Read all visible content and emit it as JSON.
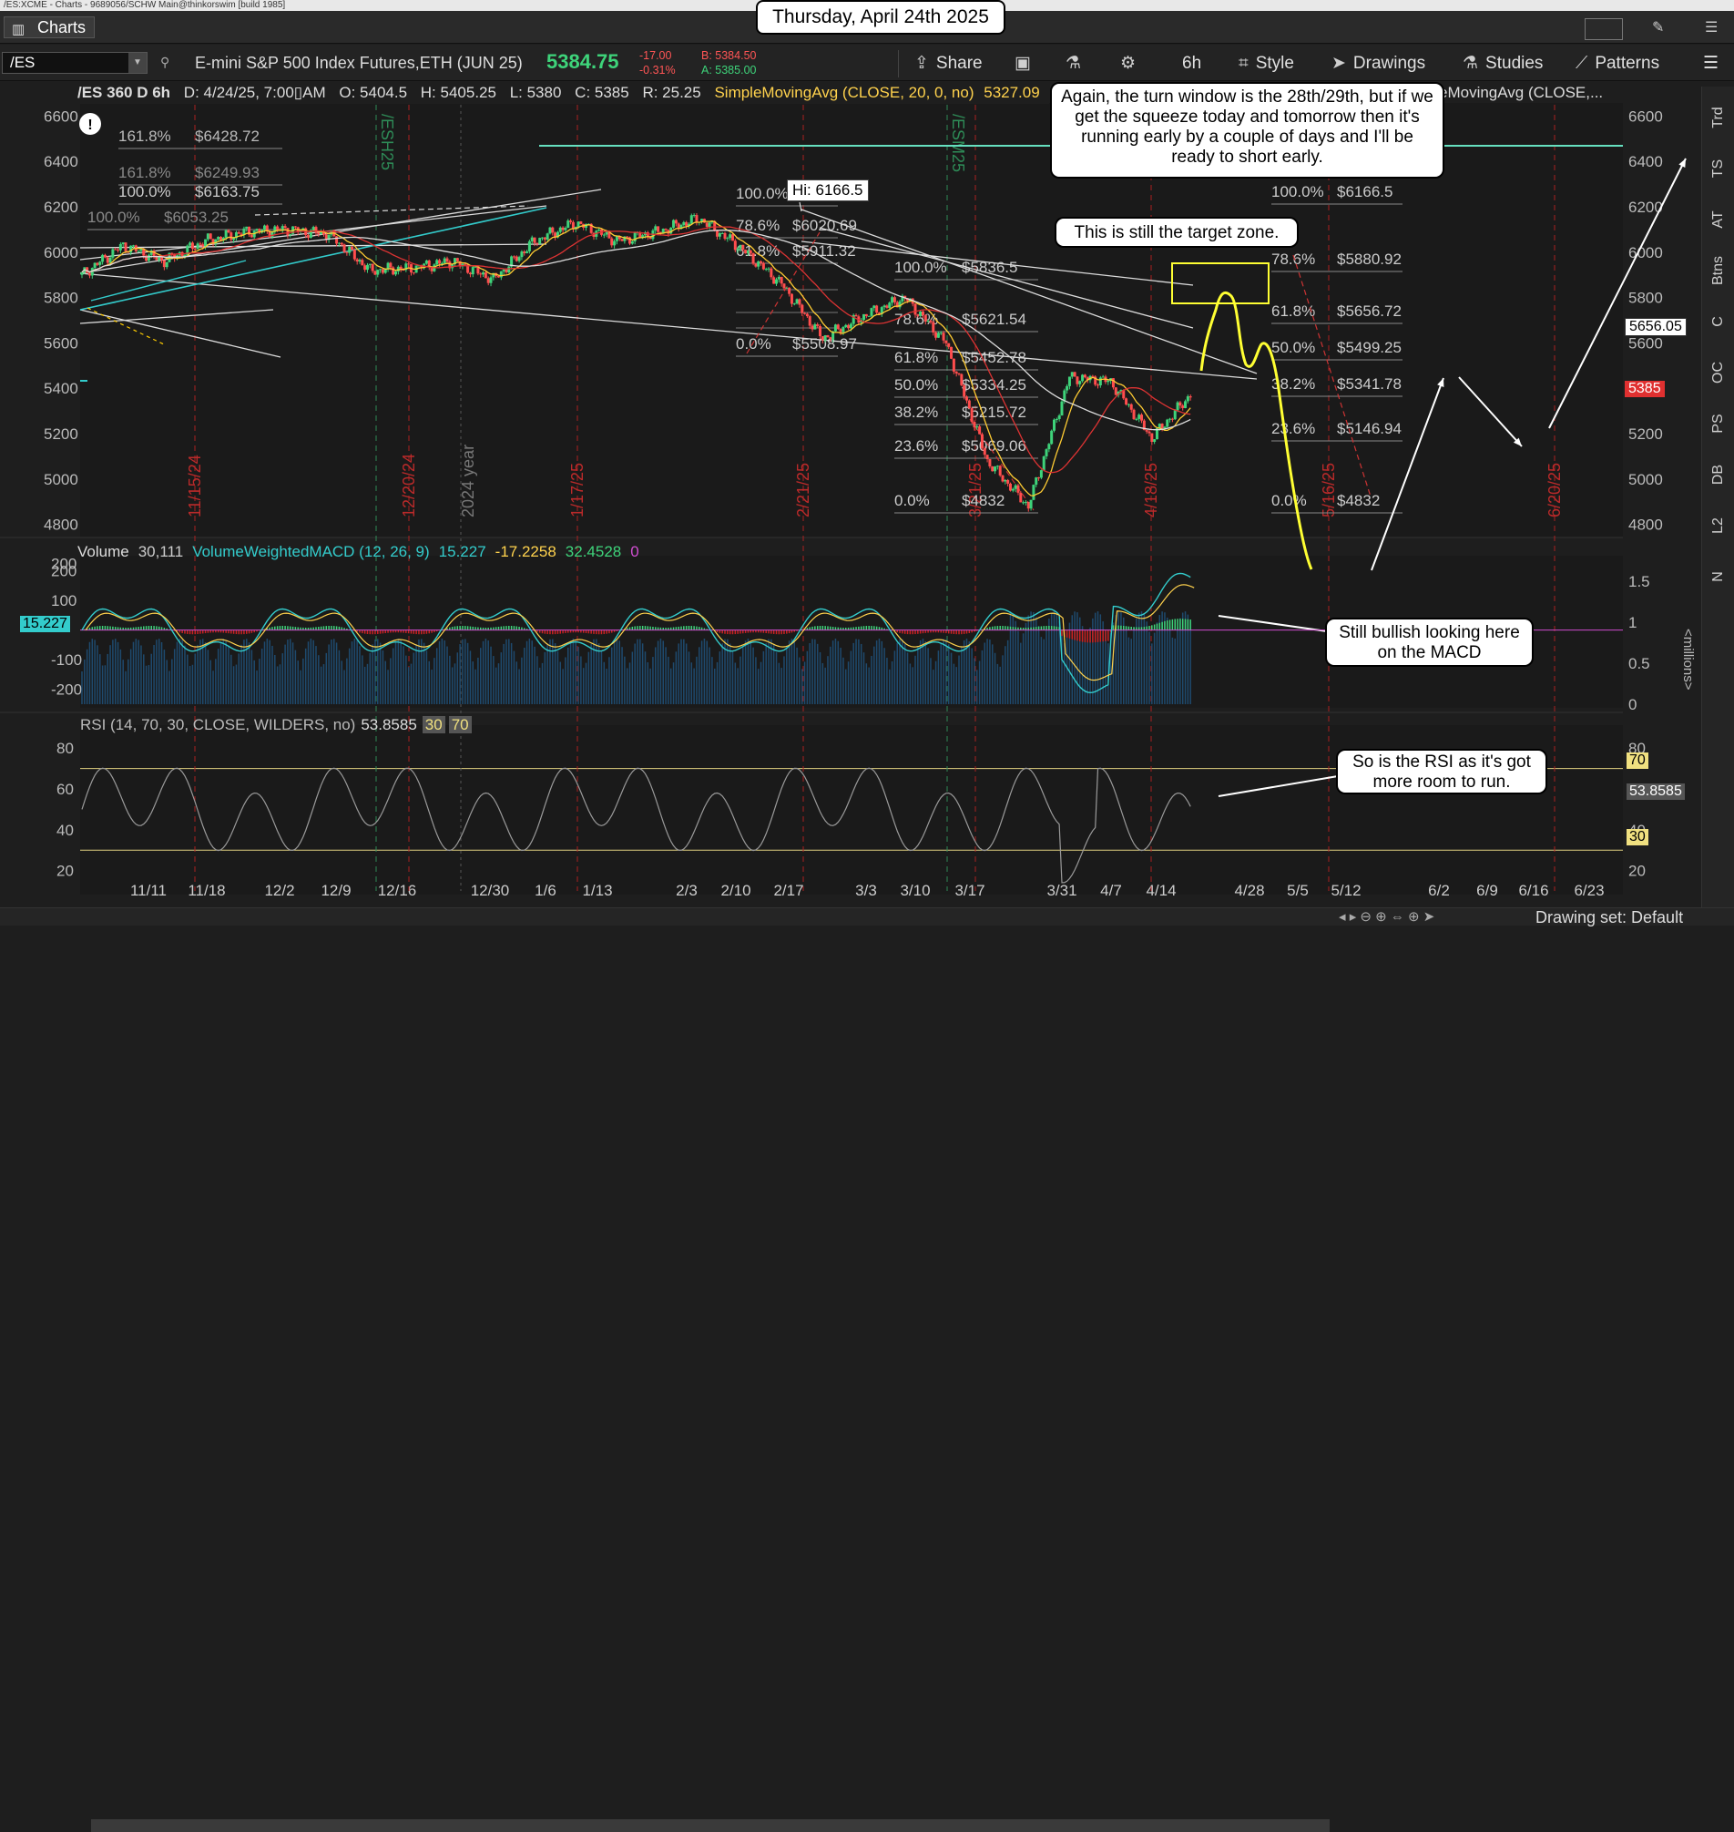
{
  "window": {
    "title": "/ES:XCME - Charts - 9689056/SCHW Main@thinkorswim [build 1985]",
    "tab_label": "Charts"
  },
  "header": {
    "date_banner": "Thursday, April 24th 2025"
  },
  "toolbar": {
    "symbol": "/ES",
    "description": "E-mini S&P 500 Index Futures,ETH (JUN 25)",
    "last": "5384.75",
    "change": "-17.00",
    "change_pct": "-0.31%",
    "bid": "B: 5384.50",
    "ask": "A: 5385.00",
    "share_label": "Share",
    "timeframe": "6h",
    "style_label": "Style",
    "drawings_label": "Drawings",
    "studies_label": "Studies",
    "patterns_label": "Patterns"
  },
  "infobar": {
    "chart_label": "/ES 360 D 6h",
    "datetime": "D: 4/24/25, 7:00▯AM",
    "open": "O: 5404.5",
    "high": "H: 5405.25",
    "low": "L: 5380",
    "close": "C: 5385",
    "range": "R: 25.25",
    "sma1": "SimpleMovingAvg (CLOSE, 20, 0, no)",
    "sma1_value": "5327.09",
    "sma2": "eMovingAvg (CLOSE,..."
  },
  "volume_panel": {
    "label": "Volume",
    "value": "30,111",
    "study": "VolumeWeightedMACD (12, 26, 9)",
    "v1": "15.227",
    "v2": "-17.2258",
    "v3": "32.4528",
    "v4": "0",
    "price_badge": "15.227",
    "millions_label": "<millions>"
  },
  "rsi_panel": {
    "label": "RSI (14, 70, 30, CLOSE, WILDERS, no)",
    "value": "53.8585",
    "ob": "30",
    "os": "70",
    "badge_70": "70",
    "badge_value": "53.8585",
    "badge_30": "30"
  },
  "price_badges": {
    "marker": "5656.05",
    "last": "5385"
  },
  "annotations": {
    "hi_label": "Hi: 6166.5",
    "note_turn_window": "Again, the turn window is the 28th/29th, but if we get the squeeze today and tomorrow then it's running early by a couple of days and I'll be ready to short early.",
    "note_target": "This is still the target zone.",
    "note_macd": "Still bullish looking here on the MACD",
    "note_rsi": "So is the RSI as it's got more room to run.",
    "year_label": "2024 year"
  },
  "fib_labels": [
    {
      "pct": "161.8%",
      "val": "$6428.72"
    },
    {
      "pct": "161.8%",
      "val": "$6249.93"
    },
    {
      "pct": "100.0%",
      "val": "$6163.75"
    },
    {
      "pct": "100.0%",
      "val": "$6053.25"
    },
    {
      "pct": "100.0%",
      "val": ""
    },
    {
      "pct": "78.6%",
      "val": "$6020.69"
    },
    {
      "pct": "61.8%",
      "val": "$5911.32"
    },
    {
      "pct": "0.0%",
      "val": "$5508.97"
    },
    {
      "pct": "100.0%",
      "val": "$5836.5"
    },
    {
      "pct": "78.6%",
      "val": "$5621.54"
    },
    {
      "pct": "61.8%",
      "val": "$5452.78"
    },
    {
      "pct": "50.0%",
      "val": "$5334.25"
    },
    {
      "pct": "38.2%",
      "val": "$5215.72"
    },
    {
      "pct": "23.6%",
      "val": "$5069.06"
    },
    {
      "pct": "0.0%",
      "val": "$4832"
    },
    {
      "pct": "100.0%",
      "val": "$6166.5"
    },
    {
      "pct": "78.6%",
      "val": "$5880.92"
    },
    {
      "pct": "61.8%",
      "val": "$5656.72"
    },
    {
      "pct": "50.0%",
      "val": "$5499.25"
    },
    {
      "pct": "38.2%",
      "val": "$5341.78"
    },
    {
      "pct": "23.6%",
      "val": "$5146.94"
    },
    {
      "pct": "0.0%",
      "val": "$4832"
    }
  ],
  "side_tabs": [
    "Trd",
    "TS",
    "AT",
    "Btns",
    "C",
    "OC",
    "PS",
    "DB",
    "L2",
    "N"
  ],
  "status": {
    "drawing_set": "Drawing set: Default"
  },
  "colors": {
    "up": "#3ed37a",
    "down": "#ff4d4d",
    "highlight_yellow": "#ffff33",
    "accent_cyan": "#33cccc"
  },
  "chart_data": {
    "type": "candlestick",
    "symbol": "/ES",
    "interval": "6h",
    "price_ylim": [
      4750,
      6650
    ],
    "y_ticks": [
      4800,
      5000,
      5200,
      5400,
      5600,
      5800,
      6000,
      6200,
      6400,
      6600
    ],
    "x_tick_labels": [
      "11/11",
      "11/18",
      "12/2",
      "12/9",
      "12/16",
      "12/30",
      "1/6",
      "1/13",
      "2/3",
      "2/10",
      "2/17",
      "3/3",
      "3/10",
      "3/17",
      "3/31",
      "4/7",
      "4/14",
      "4/28",
      "5/5",
      "5/12",
      "6/2",
      "6/9",
      "6/16",
      "6/23"
    ],
    "expiry_markers": [
      "/ESH25",
      "/ESM25"
    ],
    "vertical_date_markers": [
      "11/15/24",
      "12/20/24",
      "1/17/25",
      "2/21/25",
      "3/21/25",
      "4/18/25",
      "5/16/25",
      "6/20/25"
    ],
    "approx_closes": [
      [
        "11/6",
        5900
      ],
      [
        "11/11",
        6030
      ],
      [
        "11/18",
        5960
      ],
      [
        "11/25",
        6050
      ],
      [
        "12/2",
        6090
      ],
      [
        "12/9",
        6100
      ],
      [
        "12/16",
        6080
      ],
      [
        "12/20",
        5920
      ],
      [
        "12/30",
        5930
      ],
      [
        "1/6",
        5960
      ],
      [
        "1/13",
        5880
      ],
      [
        "1/17",
        6050
      ],
      [
        "1/24",
        6130
      ],
      [
        "2/3",
        6050
      ],
      [
        "2/10",
        6090
      ],
      [
        "2/17",
        6150
      ],
      [
        "2/21",
        6020
      ],
      [
        "3/3",
        5860
      ],
      [
        "3/10",
        5620
      ],
      [
        "3/17",
        5720
      ],
      [
        "3/25",
        5800
      ],
      [
        "3/31",
        5600
      ],
      [
        "4/4",
        5080
      ],
      [
        "4/7",
        4880
      ],
      [
        "4/9",
        5450
      ],
      [
        "4/14",
        5430
      ],
      [
        "4/21",
        5180
      ],
      [
        "4/24",
        5385
      ]
    ],
    "volume_macd_ylim": [
      -250,
      220
    ],
    "volume_macd_ticks": [
      200,
      100,
      -100,
      -200
    ],
    "volume_right_ticks": [
      1.5,
      1,
      0.5,
      0
    ],
    "rsi_ylim": [
      10,
      85
    ],
    "rsi_ticks": [
      80,
      60,
      40,
      20
    ],
    "rsi_levels": [
      30,
      70
    ]
  }
}
